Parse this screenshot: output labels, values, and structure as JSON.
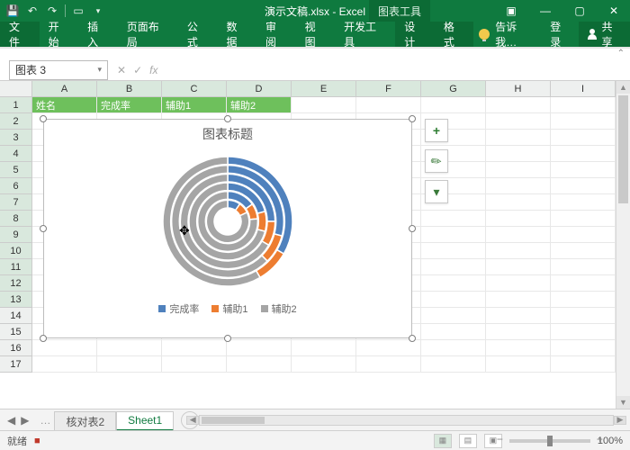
{
  "titlebar": {
    "doc_title": "演示文稿.xlsx - Excel",
    "chart_tools_label": "图表工具"
  },
  "ribbon": {
    "file": "文件",
    "tabs": [
      "开始",
      "插入",
      "页面布局",
      "公式",
      "数据",
      "审阅",
      "视图",
      "开发工具"
    ],
    "ctx_tabs": [
      "设计",
      "格式"
    ],
    "tellme": "告诉我…",
    "account": "登录",
    "share": "共享"
  },
  "formula_bar": {
    "namebox": "图表 3",
    "fx_label": "fx",
    "formula": ""
  },
  "grid": {
    "columns": [
      "A",
      "B",
      "C",
      "D",
      "E",
      "F",
      "G",
      "H",
      "I"
    ],
    "rows": [
      "1",
      "2",
      "3",
      "4",
      "5",
      "6",
      "7",
      "8",
      "9",
      "10",
      "11",
      "12",
      "13",
      "14",
      "15",
      "16",
      "17"
    ],
    "header_row": [
      "姓名",
      "完成率",
      "辅助1",
      "辅助2"
    ]
  },
  "chart": {
    "title": "图表标题",
    "legend": [
      "完成率",
      "辅助1",
      "辅助2"
    ]
  },
  "chart_data": {
    "type": "pie",
    "note": "Nested doughnut chart with 6 concentric rings; each ring has three arc segments (完成率, 辅助1, 辅助2). Values are estimated arc angles in degrees read from the figure, clockwise from 12 o'clock.",
    "title": "图表标题",
    "series_names": [
      "完成率",
      "辅助1",
      "辅助2"
    ],
    "series_colors": [
      "#4f81bd",
      "#ed7d31",
      "#a5a5a5"
    ],
    "rings": [
      {
        "ring": 1,
        "position": "outer",
        "values": [
          120,
          30,
          210
        ]
      },
      {
        "ring": 2,
        "position": "outer-mid",
        "values": [
          105,
          30,
          225
        ]
      },
      {
        "ring": 3,
        "position": "mid",
        "values": [
          90,
          30,
          240
        ]
      },
      {
        "ring": 4,
        "position": "mid-inner",
        "values": [
          75,
          30,
          255
        ]
      },
      {
        "ring": 5,
        "position": "inner-mid",
        "values": [
          55,
          30,
          275
        ]
      },
      {
        "ring": 6,
        "position": "inner",
        "values": [
          35,
          30,
          295
        ]
      }
    ],
    "legend_position": "bottom"
  },
  "chart_pills": {
    "add": "+",
    "filter": "▼"
  },
  "sheet_tabs": {
    "nav_prev": "◀",
    "nav_next": "▶",
    "dots": "…",
    "tabs": [
      "核对表2",
      "Sheet1"
    ],
    "active": "Sheet1",
    "add": "⊕"
  },
  "status_bar": {
    "mode": "就绪",
    "rec_square": "■",
    "zoom_label": "100%"
  }
}
